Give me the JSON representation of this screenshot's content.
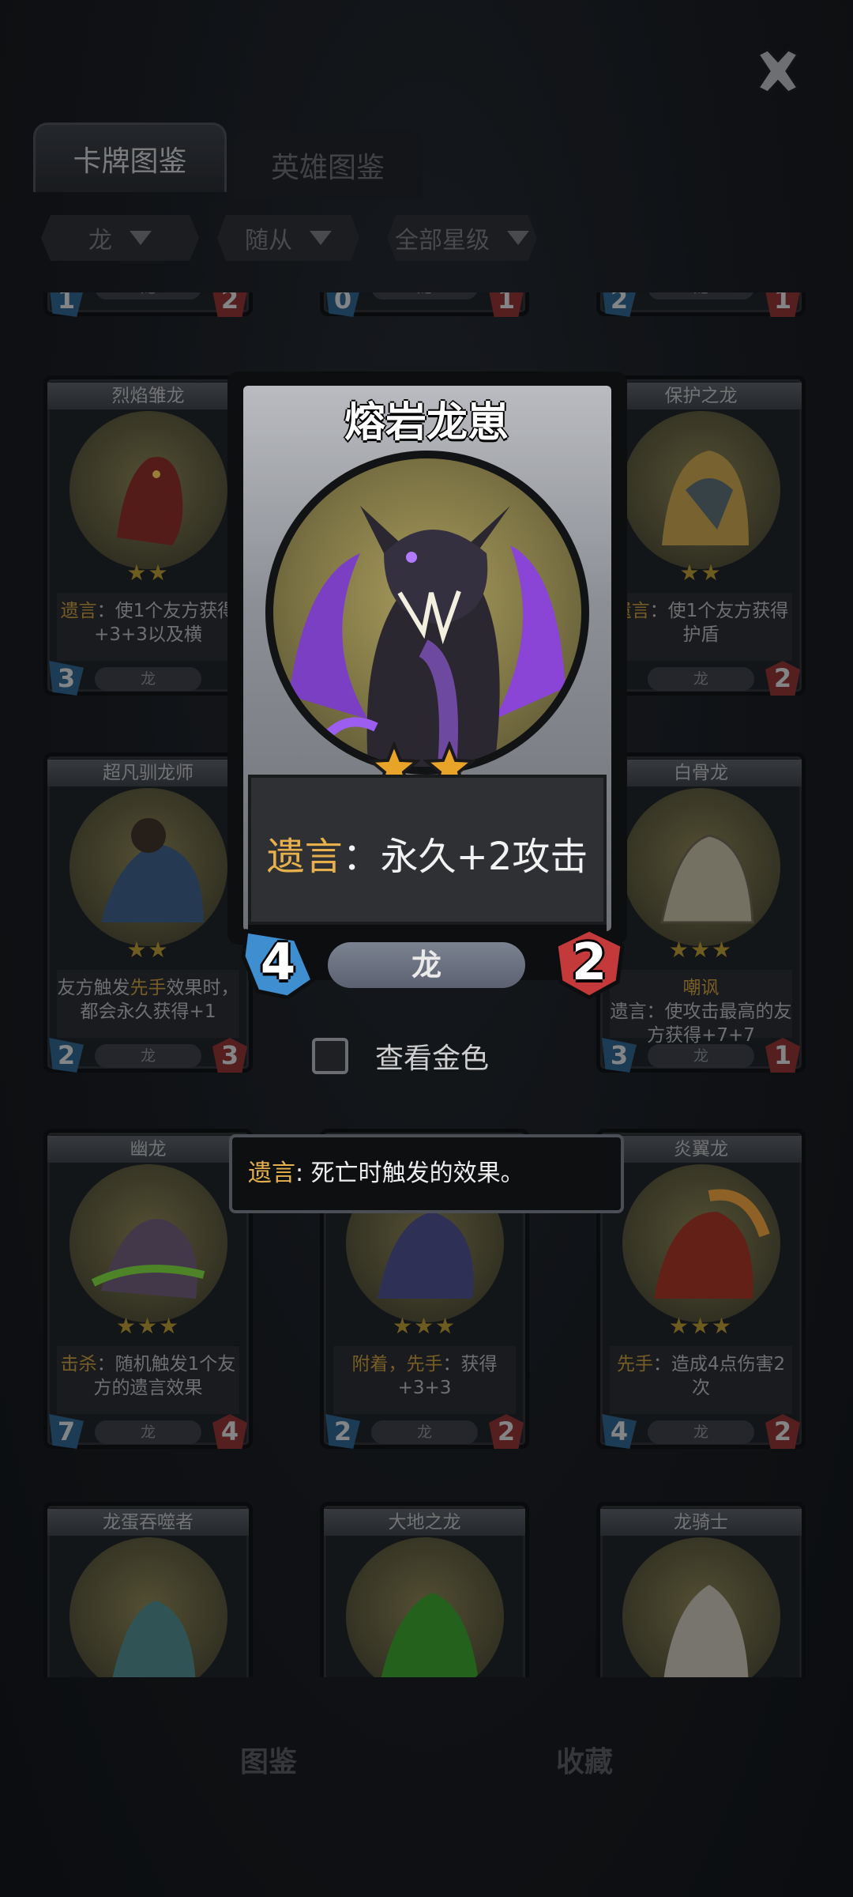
{
  "tabs": [
    {
      "label": "卡牌图鉴",
      "active": true
    },
    {
      "label": "英雄图鉴",
      "active": false
    }
  ],
  "filters": [
    {
      "label": "龙"
    },
    {
      "label": "随从"
    },
    {
      "label": "全部星级"
    }
  ],
  "cards": [
    {
      "name": "",
      "tribe": "龙",
      "attack": "1",
      "health": "2",
      "partial": true
    },
    {
      "name": "",
      "tribe": "龙",
      "attack": "0",
      "health": "1",
      "partial": true
    },
    {
      "name": "",
      "tribe": "龙",
      "attack": "2",
      "health": "1",
      "partial": true
    },
    {
      "name": "烈焰雏龙",
      "stars": "★★",
      "desc_kw": "遗言",
      "desc_rest": "：使1个友方获得+3+3以及横",
      "tribe": "龙",
      "attack": "3",
      "health": ""
    },
    {
      "name": "保护之龙",
      "stars": "★★",
      "desc_kw": "遗言",
      "desc_rest": "：使1个友方获得护盾",
      "tribe": "龙",
      "attack": "",
      "health": "2"
    },
    {
      "name": "超凡驯龙师",
      "stars": "★★",
      "desc_pre": "友方触发",
      "desc_kw": "先手",
      "desc_rest": "效果时，都会永久获得+1",
      "tribe": "龙",
      "attack": "2",
      "health": "3"
    },
    {
      "name": "白骨龙",
      "stars": "★★★",
      "desc_kw": "嘲讽",
      "desc_rest": "遗言：使攻击最高的友方获得+7+7",
      "tribe": "龙",
      "attack": "3",
      "health": "1"
    },
    {
      "name": "幽龙",
      "stars": "★★★",
      "desc_kw": "击杀",
      "desc_rest": "：随机触发1个友方的遗言效果",
      "tribe": "龙",
      "attack": "7",
      "health": "4"
    },
    {
      "name": "",
      "stars": "★★★",
      "desc_kw": "附着，先手",
      "desc_rest": "：获得+3+3",
      "tribe": "龙",
      "attack": "2",
      "health": "2"
    },
    {
      "name": "炎翼龙",
      "stars": "★★★",
      "desc_kw": "先手",
      "desc_rest": "：造成4点伤害2次",
      "tribe": "龙",
      "attack": "4",
      "health": "2"
    },
    {
      "name": "龙蛋吞噬者",
      "partial": true
    },
    {
      "name": "大地之龙",
      "partial": true
    },
    {
      "name": "龙骑士",
      "partial": true
    }
  ],
  "featured": {
    "name": "熔岩龙崽",
    "stars": 2,
    "desc_keyword": "遗言",
    "desc_separator": "：",
    "desc_text": "永久+2攻击",
    "tribe": "龙",
    "attack": "4",
    "health": "2",
    "colors": {
      "attack": "#3f8fd0",
      "health": "#c43a3a",
      "keyword": "#e7b04c",
      "star": "#e8a428"
    }
  },
  "gold_toggle": {
    "label": "查看金色",
    "checked": false
  },
  "tooltip": {
    "keyword": "遗言",
    "text": ": 死亡时触发的效果。"
  },
  "bottom_nav": [
    {
      "label": "图鉴",
      "active": true
    },
    {
      "label": "收藏",
      "active": false
    }
  ]
}
